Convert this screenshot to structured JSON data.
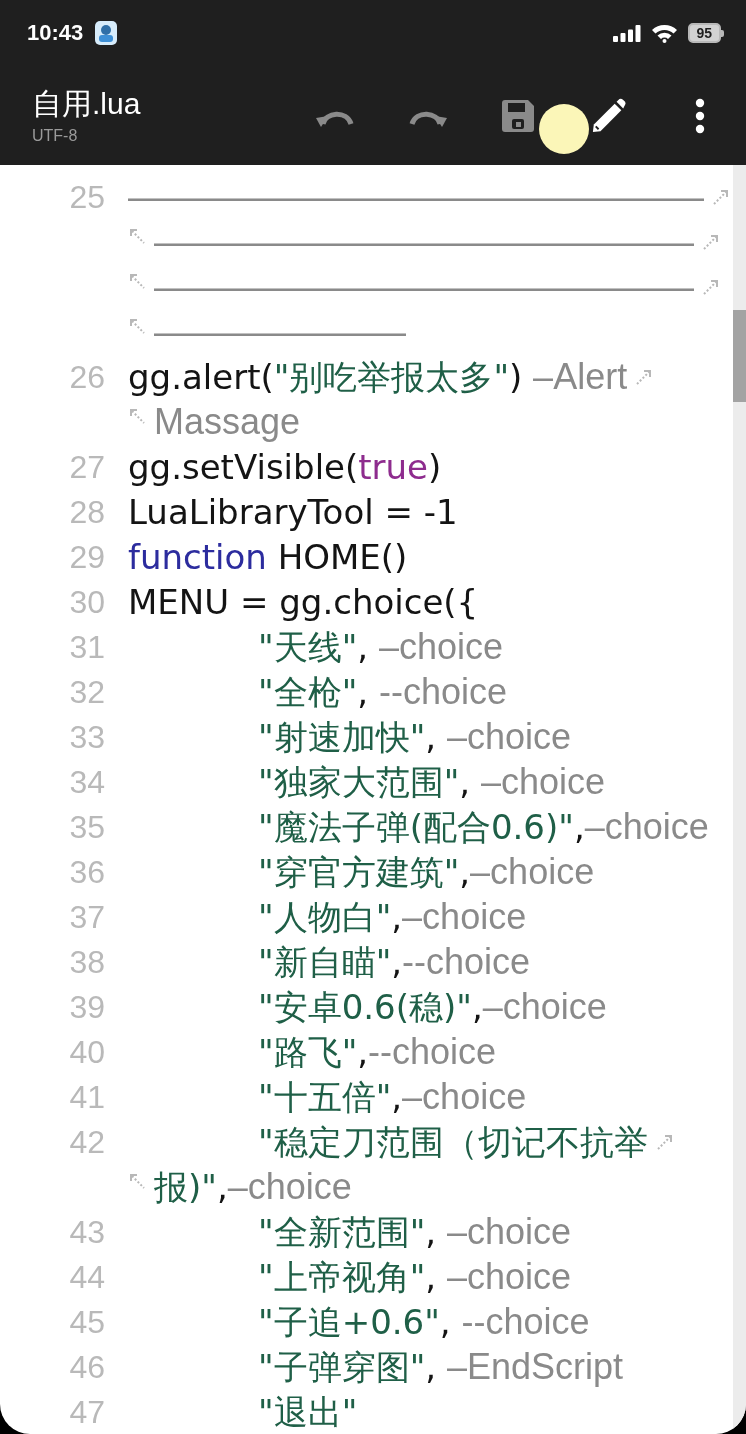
{
  "status_bar": {
    "time": "10:43",
    "battery": "95"
  },
  "toolbar": {
    "title": "自用.lua",
    "encoding": "UTF-8",
    "touch_indicator": true,
    "actions": [
      {
        "kind": "undo",
        "disabled": true
      },
      {
        "kind": "redo",
        "disabled": true
      },
      {
        "kind": "save",
        "disabled": true
      },
      {
        "kind": "edit",
        "disabled": false
      },
      {
        "kind": "more",
        "disabled": false
      }
    ]
  },
  "editor": {
    "lines": [
      {
        "number": "25",
        "segments": [
          {
            "tokens": [
              {
                "kind": "comment",
                "text": "————————————————"
              }
            ]
          },
          {
            "tokens": [
              {
                "kind": "comment",
                "text": "———————————————"
              }
            ]
          },
          {
            "tokens": [
              {
                "kind": "comment",
                "text": "———————————————"
              }
            ]
          },
          {
            "tokens": [
              {
                "kind": "comment",
                "text": "———————"
              }
            ]
          }
        ]
      },
      {
        "number": "26",
        "segments": [
          {
            "tokens": [
              {
                "kind": "plain",
                "text": "gg.alert("
              },
              {
                "kind": "string",
                "text": "\"别吃举报太多\""
              },
              {
                "kind": "plain",
                "text": ") "
              },
              {
                "kind": "comment",
                "text": "–Alert"
              }
            ]
          },
          {
            "tokens": [
              {
                "kind": "comment",
                "text": "Massage"
              }
            ]
          }
        ]
      },
      {
        "number": "27",
        "segments": [
          {
            "tokens": [
              {
                "kind": "plain",
                "text": "gg.setVisible("
              },
              {
                "kind": "literal",
                "text": "true"
              },
              {
                "kind": "plain",
                "text": ")"
              }
            ]
          }
        ]
      },
      {
        "number": "28",
        "segments": [
          {
            "tokens": [
              {
                "kind": "plain",
                "text": "LuaLibraryTool = -1"
              }
            ]
          }
        ]
      },
      {
        "number": "29",
        "segments": [
          {
            "tokens": [
              {
                "kind": "keyword",
                "text": "function"
              },
              {
                "kind": "plain",
                "text": " HOME()"
              }
            ]
          }
        ]
      },
      {
        "number": "30",
        "segments": [
          {
            "tokens": [
              {
                "kind": "plain",
                "text": "MENU = gg.choice({"
              }
            ]
          }
        ],
        "children": [
          {
            "number": "31",
            "segments": [
              {
                "tokens": [
                  {
                    "kind": "string",
                    "text": "\"天线\""
                  },
                  {
                    "kind": "plain",
                    "text": ", "
                  },
                  {
                    "kind": "comment",
                    "text": "–choice"
                  }
                ]
              }
            ]
          },
          {
            "number": "32",
            "segments": [
              {
                "tokens": [
                  {
                    "kind": "string",
                    "text": "\"全枪\""
                  },
                  {
                    "kind": "plain",
                    "text": ", "
                  },
                  {
                    "kind": "comment",
                    "text": "--choice"
                  }
                ]
              }
            ]
          },
          {
            "number": "33",
            "segments": [
              {
                "tokens": [
                  {
                    "kind": "string",
                    "text": "\"射速加快\""
                  },
                  {
                    "kind": "plain",
                    "text": ", "
                  },
                  {
                    "kind": "comment",
                    "text": "–choice"
                  }
                ]
              }
            ]
          },
          {
            "number": "34",
            "segments": [
              {
                "tokens": [
                  {
                    "kind": "string",
                    "text": "\"独家大范围\""
                  },
                  {
                    "kind": "plain",
                    "text": ", "
                  },
                  {
                    "kind": "comment",
                    "text": "–choice"
                  }
                ]
              }
            ]
          },
          {
            "number": "35",
            "segments": [
              {
                "tokens": [
                  {
                    "kind": "string",
                    "text": "\"魔法子弹(配合0.6)\""
                  },
                  {
                    "kind": "plain",
                    "text": ","
                  },
                  {
                    "kind": "comment",
                    "text": "–choice"
                  }
                ]
              }
            ]
          },
          {
            "number": "36",
            "segments": [
              {
                "tokens": [
                  {
                    "kind": "string",
                    "text": "\"穿官方建筑\""
                  },
                  {
                    "kind": "plain",
                    "text": ","
                  },
                  {
                    "kind": "comment",
                    "text": "–choice"
                  }
                ]
              }
            ]
          },
          {
            "number": "37",
            "segments": [
              {
                "tokens": [
                  {
                    "kind": "string",
                    "text": "\"人物白\""
                  },
                  {
                    "kind": "plain",
                    "text": ","
                  },
                  {
                    "kind": "comment",
                    "text": "–choice"
                  }
                ]
              }
            ]
          },
          {
            "number": "38",
            "segments": [
              {
                "tokens": [
                  {
                    "kind": "string",
                    "text": "\"新自瞄\""
                  },
                  {
                    "kind": "plain",
                    "text": ","
                  },
                  {
                    "kind": "comment",
                    "text": "--choice"
                  }
                ]
              }
            ]
          },
          {
            "number": "39",
            "segments": [
              {
                "tokens": [
                  {
                    "kind": "string",
                    "text": "\"安卓0.6(稳)\""
                  },
                  {
                    "kind": "plain",
                    "text": ","
                  },
                  {
                    "kind": "comment",
                    "text": "–choice"
                  }
                ]
              }
            ]
          },
          {
            "number": "40",
            "segments": [
              {
                "tokens": [
                  {
                    "kind": "string",
                    "text": "\"路飞\""
                  },
                  {
                    "kind": "plain",
                    "text": ","
                  },
                  {
                    "kind": "comment",
                    "text": "--choice"
                  }
                ]
              }
            ]
          },
          {
            "number": "41",
            "segments": [
              {
                "tokens": [
                  {
                    "kind": "string",
                    "text": "\"十五倍\""
                  },
                  {
                    "kind": "plain",
                    "text": ","
                  },
                  {
                    "kind": "comment",
                    "text": "–choice"
                  }
                ]
              }
            ]
          },
          {
            "number": "42",
            "segments": [
              {
                "tokens": [
                  {
                    "kind": "string",
                    "text": "\"稳定刀范围（切记不抗举"
                  }
                ]
              },
              {
                "tokens": [
                  {
                    "kind": "string",
                    "text": "报)\""
                  },
                  {
                    "kind": "plain",
                    "text": ","
                  },
                  {
                    "kind": "comment",
                    "text": "–choice"
                  }
                ]
              }
            ]
          },
          {
            "number": "43",
            "segments": [
              {
                "tokens": [
                  {
                    "kind": "string",
                    "text": "\"全新范围\""
                  },
                  {
                    "kind": "plain",
                    "text": ", "
                  },
                  {
                    "kind": "comment",
                    "text": "–choice"
                  }
                ]
              }
            ]
          },
          {
            "number": "44",
            "segments": [
              {
                "tokens": [
                  {
                    "kind": "string",
                    "text": "\"上帝视角\""
                  },
                  {
                    "kind": "plain",
                    "text": ", "
                  },
                  {
                    "kind": "comment",
                    "text": "–choice"
                  }
                ]
              }
            ]
          },
          {
            "number": "45",
            "segments": [
              {
                "tokens": [
                  {
                    "kind": "string",
                    "text": "\"子追+0.6\""
                  },
                  {
                    "kind": "plain",
                    "text": ", "
                  },
                  {
                    "kind": "comment",
                    "text": "--choice"
                  }
                ]
              }
            ]
          },
          {
            "number": "46",
            "segments": [
              {
                "tokens": [
                  {
                    "kind": "string",
                    "text": "\"子弹穿图\""
                  },
                  {
                    "kind": "plain",
                    "text": ", "
                  },
                  {
                    "kind": "comment",
                    "text": "–EndScript"
                  }
                ]
              }
            ]
          },
          {
            "number": "47",
            "segments": [
              {
                "tokens": [
                  {
                    "kind": "string",
                    "text": "\"退出\""
                  }
                ]
              }
            ]
          }
        ]
      }
    ]
  }
}
